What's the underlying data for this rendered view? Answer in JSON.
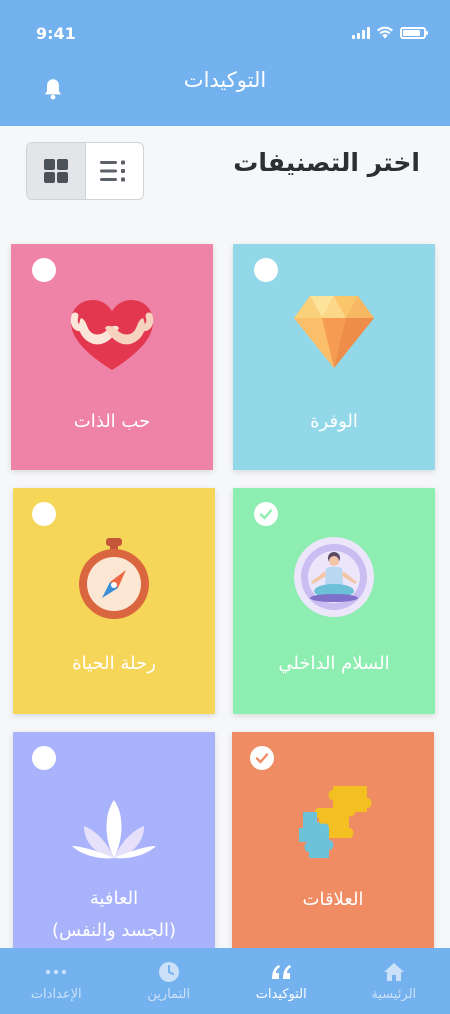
{
  "status": {
    "time": "9:41"
  },
  "header": {
    "title": "التوكيدات",
    "bell_icon": "bell-icon"
  },
  "section": {
    "title": "اختر التصنيفات"
  },
  "view_toggle": {
    "active": "grid",
    "grid_icon": "grid-view-icon",
    "list_icon": "list-view-icon"
  },
  "colors": {
    "header": "#74b1ef",
    "self_love": "#ef83a7",
    "abundance": "#92d8e8",
    "life_journey": "#f6d659",
    "inner_peace": "#8eedb1",
    "wellness": "#a9b3fb",
    "relationships": "#ef8c64"
  },
  "categories": [
    {
      "id": "abundance",
      "label": "الوفرة",
      "icon": "diamond-icon",
      "selected": false
    },
    {
      "id": "self_love",
      "label": "حب الذات",
      "icon": "heart-hug-icon",
      "selected": false
    },
    {
      "id": "inner_peace",
      "label": "السلام الداخلي",
      "icon": "meditation-icon",
      "selected": true
    },
    {
      "id": "life_journey",
      "label": "رحلة الحياة",
      "icon": "compass-icon",
      "selected": false
    },
    {
      "id": "relationships",
      "label": "العلاقات",
      "icon": "puzzle-icon",
      "selected": true
    },
    {
      "id": "wellness",
      "label": "العافية",
      "label_line2": "(الجسد والنفس)",
      "icon": "lotus-icon",
      "selected": false
    }
  ],
  "nav": {
    "items": [
      {
        "label": "الرئيسية",
        "icon": "home-icon",
        "active": false
      },
      {
        "label": "التوكيدات",
        "icon": "quote-icon",
        "active": true
      },
      {
        "label": "التمارين",
        "icon": "clock-icon",
        "active": false
      },
      {
        "label": "الإعدادات",
        "icon": "more-dots-icon",
        "active": false
      }
    ]
  }
}
